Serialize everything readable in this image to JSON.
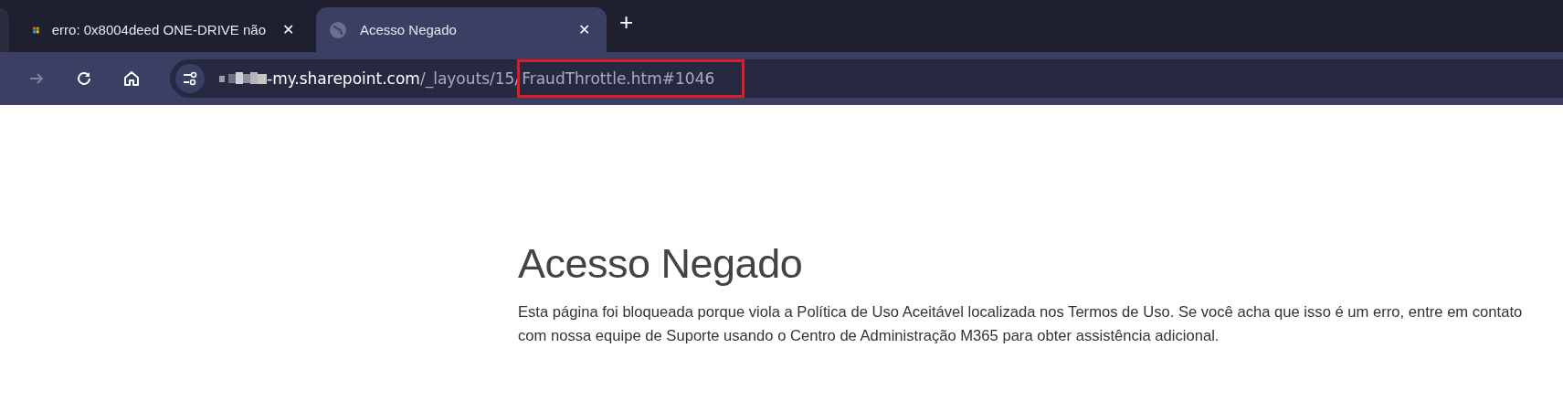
{
  "tabs": [
    {
      "title": "erro: 0x8004deed ONE-DRIVE não",
      "selected": false,
      "close": "✕"
    },
    {
      "title": "Acesso Negado",
      "selected": true,
      "close": "✕"
    }
  ],
  "new_tab": "+",
  "address_bar": {
    "host": "-my.sharepoint.com",
    "path": "/_layouts/15/",
    "highlighted": "FraudThrottle.htm#1046"
  },
  "page": {
    "heading": "Acesso Negado",
    "message": "Esta página foi bloqueada porque viola a Política de Uso Aceitável localizada nos Termos de Uso. Se você acha que isso é um erro, entre em contato com nossa equipe de Suporte usando o Centro de Administração M365 para obter assistência adicional."
  }
}
